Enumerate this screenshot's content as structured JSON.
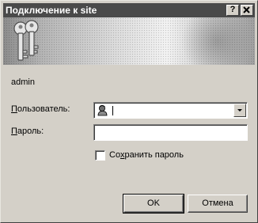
{
  "window": {
    "title": "Подключение к site",
    "help_button": "?",
    "close_button": "×"
  },
  "banner": {
    "icon": "keys-icon"
  },
  "server_label": "admin",
  "form": {
    "user": {
      "label_underlined": "П",
      "label_rest": "ользователь:",
      "value": "",
      "icon": "user-icon"
    },
    "password": {
      "label_underlined": "П",
      "label_rest": "ароль:",
      "value": ""
    },
    "save_password": {
      "label_before": "Со",
      "label_underlined": "х",
      "label_after": "ранить пароль",
      "checked": false
    }
  },
  "buttons": {
    "ok": "OK",
    "cancel": "Отмена"
  }
}
